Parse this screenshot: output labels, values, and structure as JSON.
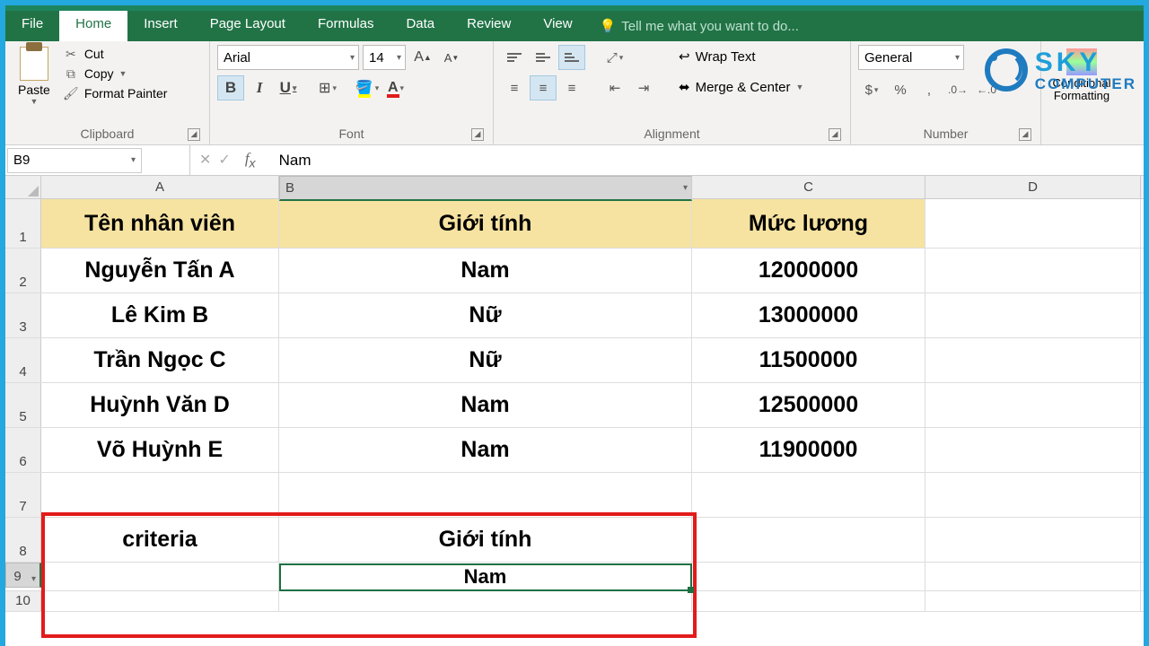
{
  "tabs": {
    "file": "File",
    "home": "Home",
    "insert": "Insert",
    "page_layout": "Page Layout",
    "formulas": "Formulas",
    "data": "Data",
    "review": "Review",
    "view": "View",
    "tell": "Tell me what you want to do..."
  },
  "clipboard": {
    "paste": "Paste",
    "cut": "Cut",
    "copy": "Copy",
    "format_painter": "Format Painter",
    "group": "Clipboard"
  },
  "font": {
    "family": "Arial",
    "size": "14",
    "group": "Font"
  },
  "alignment": {
    "wrap": "Wrap Text",
    "merge": "Merge & Center",
    "group": "Alignment"
  },
  "number": {
    "format": "General",
    "group": "Number",
    "cond": "Conditional Formatting"
  },
  "fx": {
    "name": "B9",
    "value": "Nam"
  },
  "cols": [
    "A",
    "B",
    "C",
    "D"
  ],
  "rows": [
    "1",
    "2",
    "3",
    "4",
    "5",
    "6",
    "7",
    "8",
    "9",
    "10"
  ],
  "data": {
    "h": [
      "Tên nhân viên",
      "Giới tính",
      "Mức lương"
    ],
    "body": [
      [
        "Nguyễn Tấn A",
        "Nam",
        "12000000"
      ],
      [
        "Lê Kim B",
        "Nữ",
        "13000000"
      ],
      [
        "Trần Ngọc C",
        "Nữ",
        "11500000"
      ],
      [
        "Huỳnh Văn D",
        "Nam",
        "12500000"
      ],
      [
        "Võ Huỳnh E",
        "Nam",
        "11900000"
      ]
    ],
    "crit_label": "criteria",
    "crit_hdr": "Giới tính",
    "crit_val": "Nam"
  },
  "logo": {
    "l1": "SKY",
    "l2": "COMPUTER"
  }
}
